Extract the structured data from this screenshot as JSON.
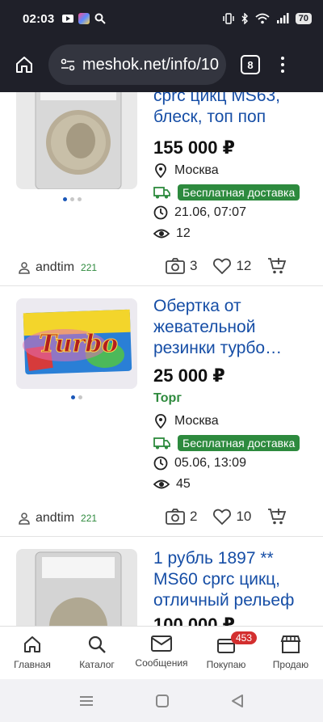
{
  "status_bar": {
    "time": "02:03",
    "battery": "70"
  },
  "browser": {
    "url": "meshok.net/info/10",
    "tab_count": "8"
  },
  "listings": [
    {
      "title": "cprc цикц MS63, блеск, топ поп",
      "price": "155 000 ₽",
      "city": "Москва",
      "delivery": "Бесплатная доставка",
      "date": "21.06, 07:07",
      "views": "12",
      "seller": "andtim",
      "seller_rating": "221",
      "photos": "3",
      "likes": "12"
    },
    {
      "title": "Обертка от жевательной резинки турбо…",
      "price": "25 000 ₽",
      "torg": "Торг",
      "city": "Москва",
      "delivery": "Бесплатная доставка",
      "date": "05.06, 13:09",
      "views": "45",
      "seller": "andtim",
      "seller_rating": "221",
      "photos": "2",
      "likes": "10"
    },
    {
      "title": "1 рубль 1897 ** MS60 cprc цикц, отличный рельеф",
      "price": "100 000 ₽"
    }
  ],
  "wrapper_image_text": "Turbo",
  "bottom_nav": {
    "items": [
      "Главная",
      "Каталог",
      "Сообщения",
      "Покупаю",
      "Продаю"
    ],
    "buy_badge": "453"
  },
  "colors": {
    "title": "#164ea6",
    "badge_green": "#2d8a3e",
    "nav_badge": "#d32f2f"
  }
}
